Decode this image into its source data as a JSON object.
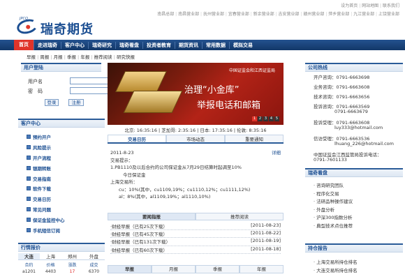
{
  "top_links": [
    "设为首页",
    "网站地图",
    "联系我们"
  ],
  "branches": [
    "南昌总部",
    "南昌营业部",
    "抚州营业部",
    "宜春营业部",
    "新余营业部",
    "吉安营业部",
    "赣州营业部",
    "萍乡营业部",
    "九江营业部",
    "上饶营业部"
  ],
  "logo": {
    "small_text": "JPCO",
    "name": "瑞奇期货",
    "sub": "RICH"
  },
  "main_nav": [
    "首页",
    "走进瑞奇",
    "客户中心",
    "瑞奇研究",
    "瑞奇看盘",
    "投资者教育",
    "期货资讯",
    "常用数据",
    "模拟交易"
  ],
  "sub_nav": [
    "早报",
    "周报",
    "月报",
    "季报",
    "年报",
    "推荐阅读",
    "研究快报"
  ],
  "login": {
    "title": "用户登陆",
    "username_label": "用户名",
    "password_label": "密　码",
    "login_button": "登录",
    "register_button": "注册"
  },
  "customer_service": {
    "title": "客户中心",
    "items": [
      "预约开户",
      "风险提示",
      "开户流程",
      "银期转账",
      "交易指南",
      "软件下载",
      "交易日历",
      "常见问题",
      "保证金监控中心",
      "手机短信订阅"
    ]
  },
  "quotes": {
    "title": "行情报价",
    "tabs": [
      "大连",
      "上海",
      "郑州",
      "外盘"
    ],
    "columns": [
      "合约",
      "价格",
      "涨跌",
      "成交"
    ],
    "first_row": [
      "a1201",
      "4403",
      "17",
      "6370"
    ]
  },
  "banner": {
    "top_text": "中国证监会和江西证监局",
    "line1": "治理“小金库”",
    "line2": "举报电话和邮箱",
    "pages": [
      "1",
      "2",
      "3",
      "4",
      "5"
    ]
  },
  "clocks": "北京: 16:35:16 | 芝加哥: 2:35:16 | 日本: 17:35:16 | 伦敦: 8:35:16",
  "content_tabs": [
    "交易日历",
    "市场动态",
    "重要通知"
  ],
  "notice": {
    "date": "2011-8-23",
    "detail_link": "详细",
    "line1": "交易提示：",
    "line2": "1.PB1110及以后合约的公司保证金从7月29日结算时起调至10%",
    "line3": "今日保证金",
    "line4": "上海交易所：",
    "line5": "cu：10%(其中，cu1109,19%；cu1110,12%；cu1111,12%)",
    "line6": "al：8%(其中，al1109,19%；al1110,10%)"
  },
  "news_tabs": [
    "要闻指报",
    "推荐阅读"
  ],
  "news": [
    {
      "title": "·财经早报（已有25次下载）",
      "date": "[2011-08-23]"
    },
    {
      "title": "·财经早报（已有45次下载）",
      "date": "[2011-08-22]"
    },
    {
      "title": "·财经早报（已有131次下载）",
      "date": "[2011-08-19]"
    },
    {
      "title": "·财经早报（已有60次下载）",
      "date": "[2011-08-18]"
    }
  ],
  "bottom_tabs": [
    "早报",
    "月报",
    "季报",
    "年报"
  ],
  "hotline": {
    "title": "公司热线",
    "items": [
      "开户咨询：0791-6663698",
      "业务咨询：0791-6663608",
      "技术咨询：0791-6663656",
      "投诉咨询：0791-6663569",
      "0791-6663679",
      "投诉受理：0791-6663608",
      "luy333@hotmail.com",
      "信访受理：0791-6663536",
      "lhuang_226@hotmail.com",
      "中国证监会江西监管局投诉电话：",
      "0791-7601133"
    ]
  },
  "investor": {
    "title": "瑞奇看盘",
    "items": [
      "咨询研究团队",
      "程序化交易",
      "法研品种操作建议",
      "外盘分析",
      "沪深300指数分析",
      "典型技术点位推荐"
    ]
  },
  "exchange": {
    "title": "持仓报告",
    "items": [
      "上海交易所持仓排名",
      "大连交易所持仓排名"
    ]
  }
}
